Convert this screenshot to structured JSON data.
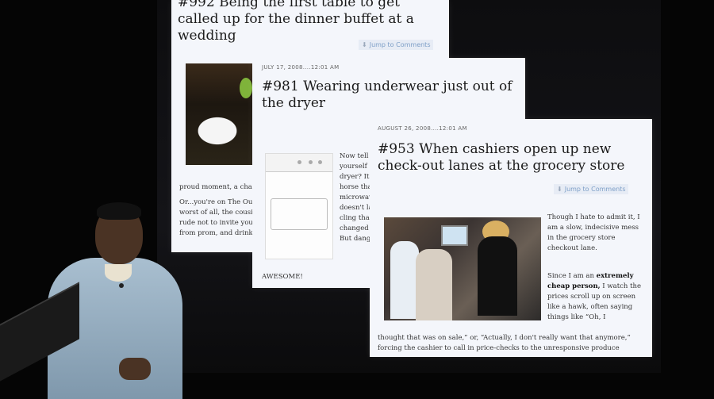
{
  "slides": [
    {
      "id": "992",
      "title": "#992 Being the first table to get called up for the dinner buffet at a wedding",
      "jump_label": "Jump to Comments",
      "text_lines": [
        "proud moment, a chan",
        "Or...you're on The Ou",
        "worst of all, the cousi",
        "rude not to invite you,",
        "from prom, and drink t"
      ]
    },
    {
      "id": "981",
      "date": "JULY 17, 2008....12:01 AM",
      "title": "#981 Wearing underwear just out of the dryer",
      "text_lines": [
        "Now tell",
        "yourself",
        "dryer? It",
        "horse tha",
        "microwav",
        "doesn't la",
        "cling tha",
        "changed",
        "But dang,"
      ],
      "footer": "AWESOME!"
    },
    {
      "id": "953",
      "date": "AUGUST 26, 2008....12:01 AM",
      "title": "#953 When cashiers open up new check-out lanes at the grocery store",
      "jump_label": "Jump to Comments",
      "para1": "Though I hate to admit it, I am a slow, indecisive mess in the grocery store checkout lane.",
      "para2_pre": "Since I am an ",
      "para2_bold": "extremely cheap person,",
      "para2_post": " I watch the prices scroll up on screen like a hawk, often saying things like “Oh, I",
      "para3": "thought that was on sale,” or, “Actually, I don't really want that anymore,” forcing the cashier to call in price-checks to the unresponsive produce"
    }
  ]
}
